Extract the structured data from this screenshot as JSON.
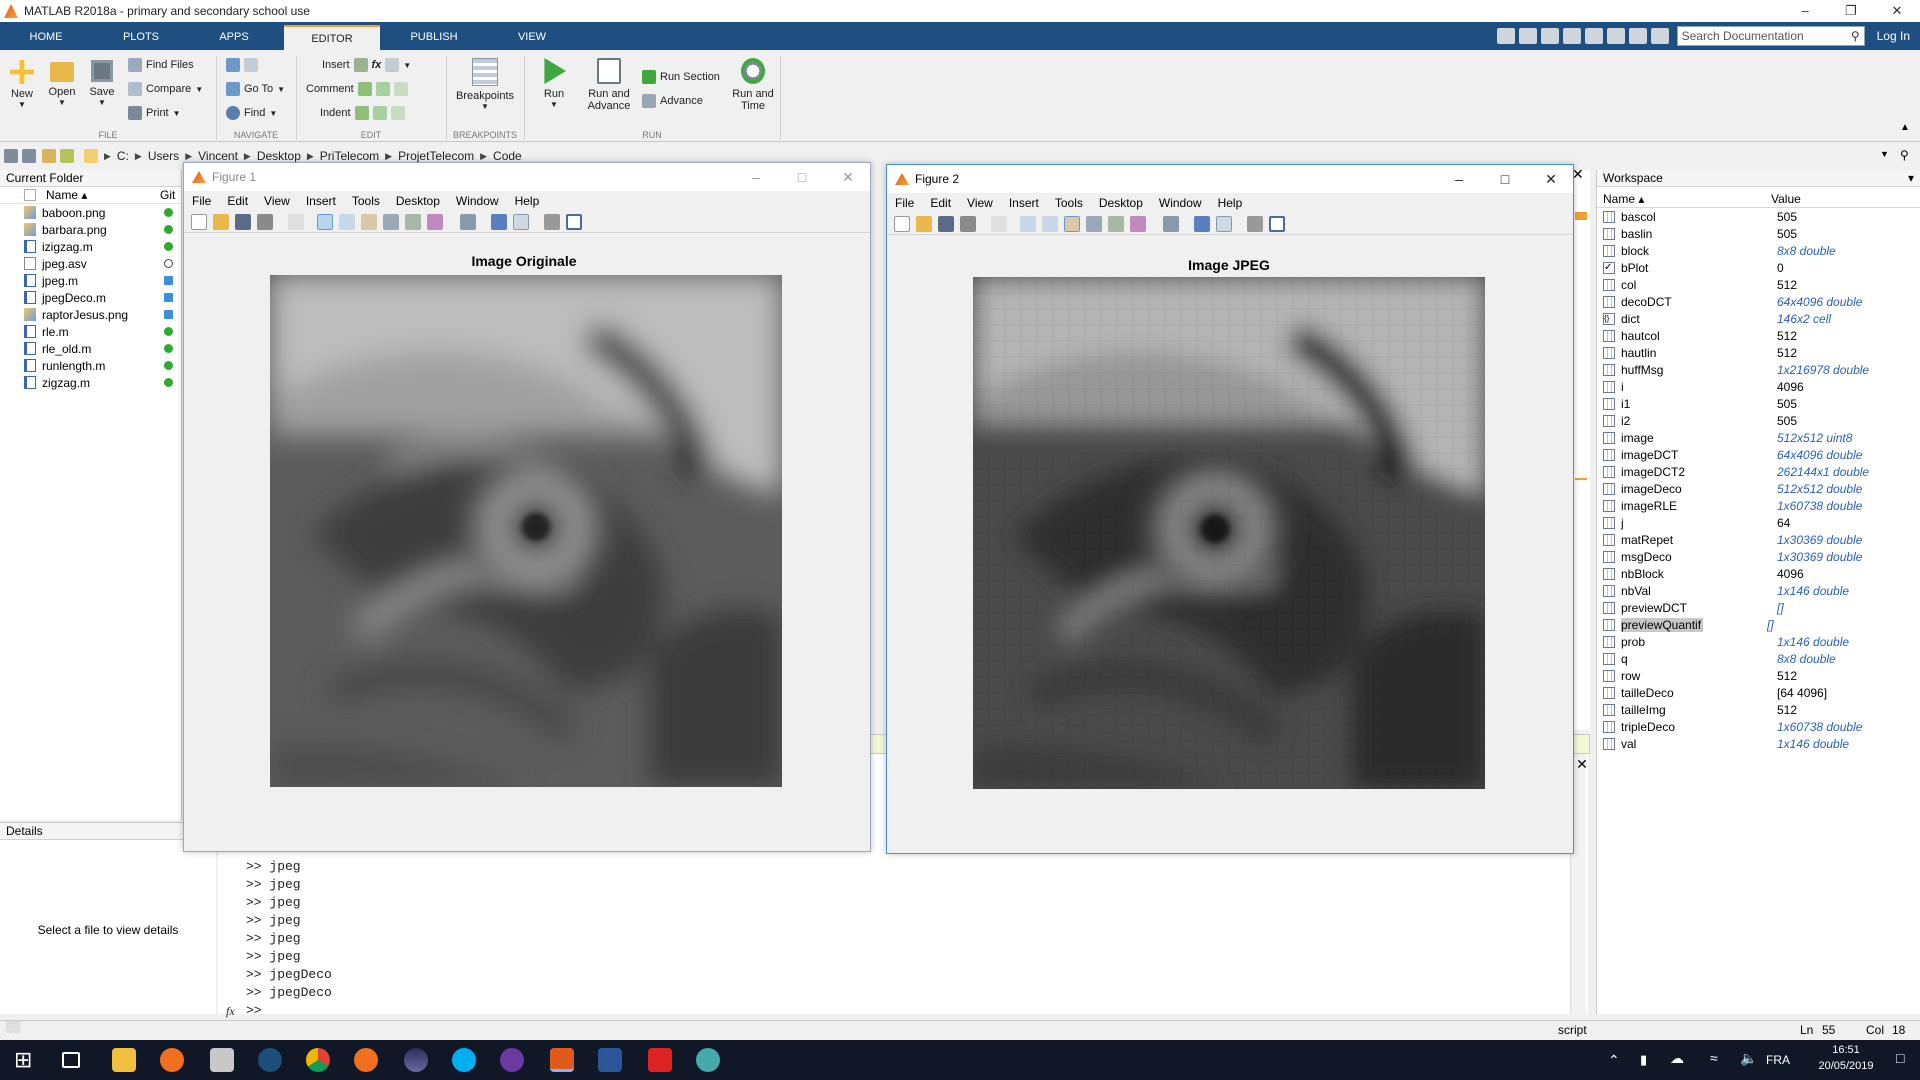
{
  "window": {
    "title": "MATLAB R2018a - primary and secondary school use"
  },
  "ribbon_tabs": [
    "HOME",
    "PLOTS",
    "APPS",
    "EDITOR",
    "PUBLISH",
    "VIEW"
  ],
  "active_tab": "EDITOR",
  "search": {
    "placeholder": "Search Documentation"
  },
  "login_label": "Log In",
  "ribbon": {
    "file": {
      "new": "New",
      "open": "Open",
      "save": "Save",
      "find_files": "Find Files",
      "compare": "Compare",
      "print": "Print",
      "group": "FILE"
    },
    "navigate": {
      "go_to": "Go To",
      "find": "Find",
      "group": "NAVIGATE"
    },
    "edit": {
      "insert": "Insert",
      "comment": "Comment",
      "indent": "Indent",
      "fx": "fx",
      "group": "EDIT"
    },
    "breakpoints": {
      "label": "Breakpoints",
      "group": "BREAKPOINTS"
    },
    "run": {
      "run": "Run",
      "run_advance_1": "Run and",
      "run_advance_2": "Advance",
      "run_section": "Run Section",
      "advance": "Advance",
      "run_time_1": "Run and",
      "run_time_2": "Time",
      "group": "RUN"
    }
  },
  "path": [
    "C:",
    "Users",
    "Vincent",
    "Desktop",
    "PriTelecom",
    "ProjetTelecom",
    "Code"
  ],
  "current_folder": {
    "title": "Current Folder",
    "col_name": "Name ▴",
    "col_git": "Git",
    "files": [
      {
        "name": "baboon.png",
        "type": "image",
        "git": "#2eaa2e"
      },
      {
        "name": "barbara.png",
        "type": "image",
        "git": "#2eaa2e"
      },
      {
        "name": "izigzag.m",
        "type": "m",
        "git": "#2eaa2e"
      },
      {
        "name": "jpeg.asv",
        "type": "asv",
        "git": "hollow"
      },
      {
        "name": "jpeg.m",
        "type": "m",
        "git": "#3b8fe0"
      },
      {
        "name": "jpegDeco.m",
        "type": "m",
        "git": "#3b8fe0"
      },
      {
        "name": "raptorJesus.png",
        "type": "image",
        "git": "#3b8fe0"
      },
      {
        "name": "rle.m",
        "type": "m",
        "git": "#2eaa2e"
      },
      {
        "name": "rle_old.m",
        "type": "m",
        "git": "#2eaa2e"
      },
      {
        "name": "runlength.m",
        "type": "m",
        "git": "#2eaa2e"
      },
      {
        "name": "zigzag.m",
        "type": "m",
        "git": "#2eaa2e"
      }
    ]
  },
  "details": {
    "title": "Details",
    "message": "Select a file to view details"
  },
  "command_window": {
    "lines": [
      ">> jpeg",
      ">> jpeg",
      ">> jpeg",
      ">> jpeg",
      ">> jpeg",
      ">> jpeg",
      ">> jpegDeco",
      ">> jpegDeco"
    ],
    "prompt": ">>",
    "fx": "fx"
  },
  "figure1": {
    "title": "Figure 1",
    "axes_title": "Image Originale",
    "menu": [
      "File",
      "Edit",
      "View",
      "Insert",
      "Tools",
      "Desktop",
      "Window",
      "Help"
    ]
  },
  "figure2": {
    "title": "Figure 2",
    "axes_title": "Image JPEG",
    "menu": [
      "File",
      "Edit",
      "View",
      "Insert",
      "Tools",
      "Desktop",
      "Window",
      "Help"
    ]
  },
  "workspace": {
    "title": "Workspace",
    "col_name": "Name ▴",
    "col_value": "Value",
    "vars": [
      {
        "name": "bascol",
        "value": "505",
        "italic": false
      },
      {
        "name": "baslin",
        "value": "505",
        "italic": false
      },
      {
        "name": "block",
        "value": "8x8 double",
        "italic": true
      },
      {
        "name": "bPlot",
        "value": "0",
        "italic": false
      },
      {
        "name": "col",
        "value": "512",
        "italic": false
      },
      {
        "name": "decoDCT",
        "value": "64x4096 double",
        "italic": true
      },
      {
        "name": "dict",
        "value": "146x2 cell",
        "italic": true
      },
      {
        "name": "hautcol",
        "value": "512",
        "italic": false
      },
      {
        "name": "hautlin",
        "value": "512",
        "italic": false
      },
      {
        "name": "huffMsg",
        "value": "1x216978 double",
        "italic": true
      },
      {
        "name": "i",
        "value": "4096",
        "italic": false
      },
      {
        "name": "i1",
        "value": "505",
        "italic": false
      },
      {
        "name": "i2",
        "value": "505",
        "italic": false
      },
      {
        "name": "image",
        "value": "512x512 uint8",
        "italic": true
      },
      {
        "name": "imageDCT",
        "value": "64x4096 double",
        "italic": true
      },
      {
        "name": "imageDCT2",
        "value": "262144x1 double",
        "italic": true
      },
      {
        "name": "imageDeco",
        "value": "512x512 double",
        "italic": true
      },
      {
        "name": "imageRLE",
        "value": "1x60738 double",
        "italic": true
      },
      {
        "name": "j",
        "value": "64",
        "italic": false
      },
      {
        "name": "matRepet",
        "value": "1x30369 double",
        "italic": true
      },
      {
        "name": "msgDeco",
        "value": "1x30369 double",
        "italic": true
      },
      {
        "name": "nbBlock",
        "value": "4096",
        "italic": false
      },
      {
        "name": "nbVal",
        "value": "1x146 double",
        "italic": true
      },
      {
        "name": "previewDCT",
        "value": "[]",
        "italic": true
      },
      {
        "name": "previewQuantif",
        "value": "[]",
        "italic": true
      },
      {
        "name": "prob",
        "value": "1x146 double",
        "italic": true
      },
      {
        "name": "q",
        "value": "8x8 double",
        "italic": true
      },
      {
        "name": "row",
        "value": "512",
        "italic": false
      },
      {
        "name": "tailleDeco",
        "value": "[64 4096]",
        "italic": false
      },
      {
        "name": "tailleImg",
        "value": "512",
        "italic": false
      },
      {
        "name": "tripleDeco",
        "value": "1x60738 double",
        "italic": true
      },
      {
        "name": "val",
        "value": "1x146 double",
        "italic": true
      }
    ]
  },
  "statusbar": {
    "mode": "script",
    "ln_label": "Ln",
    "ln": "55",
    "col_label": "Col",
    "col": "18"
  },
  "taskbar": {
    "lang": "FRA",
    "time": "16:51",
    "date": "20/05/2019"
  }
}
